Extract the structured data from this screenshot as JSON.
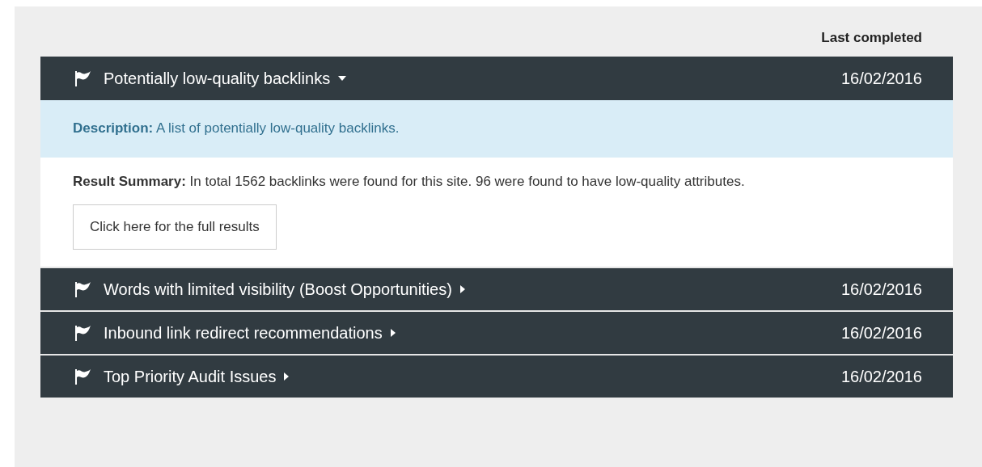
{
  "column_header": "Last completed",
  "reports": [
    {
      "title": "Potentially low-quality backlinks",
      "date": "16/02/2016",
      "expanded": true,
      "description": "**Description:** A list of potentially low-quality backlinks.",
      "summary": "**Result Summary:** In total 1562 backlinks were found for this site. 96 were found to have low-quality attributes.",
      "button": "Click here for the full results"
    },
    {
      "title": "Words with limited visibility (Boost Opportunities)",
      "date": "16/02/2016",
      "expanded": false
    },
    {
      "title": "Inbound link redirect recommendations",
      "date": "16/02/2016",
      "expanded": false
    },
    {
      "title": "Top Priority Audit Issues",
      "date": "16/02/2016",
      "expanded": false
    }
  ]
}
